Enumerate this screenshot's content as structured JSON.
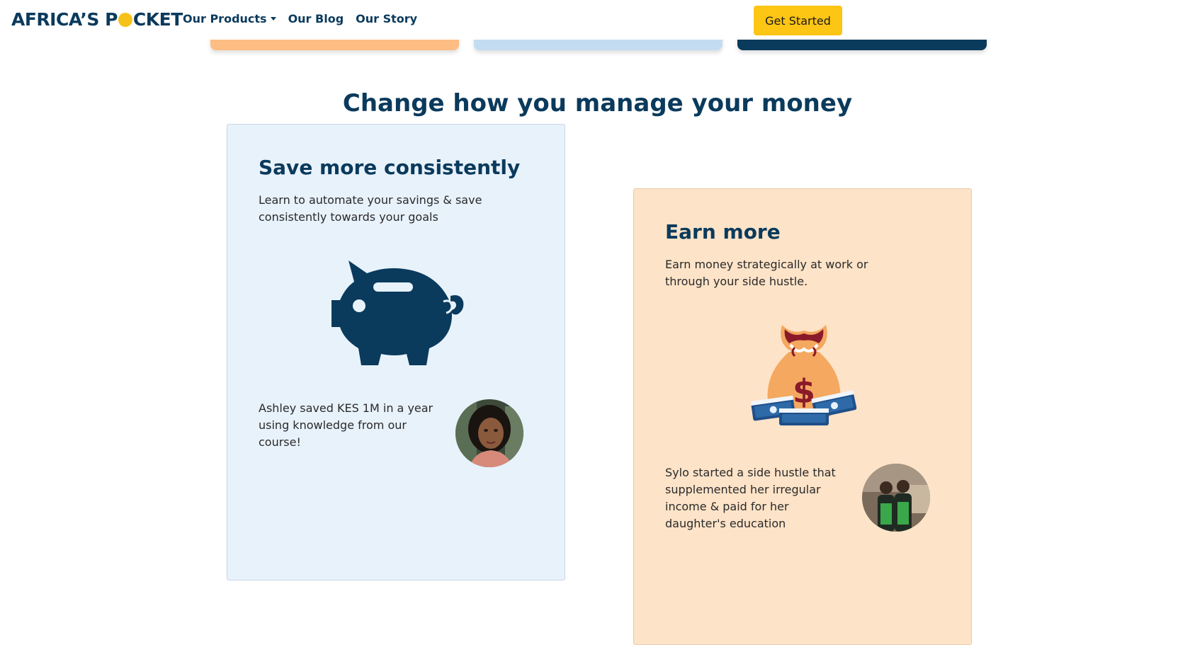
{
  "nav": {
    "brand_left": "AFRICA’S P",
    "brand_right": "CKET",
    "products": "Our Products",
    "blog": "Our Blog",
    "story": "Our Story",
    "cta": "Get Started"
  },
  "section": {
    "title": "Change how you manage your money"
  },
  "cards": {
    "save": {
      "title": "Save more consistently",
      "description": "Learn to automate your savings & save consistently towards your goals",
      "testimonial": "Ashley saved KES 1M in a year using knowledge from our course!",
      "icon": "piggy-bank-icon"
    },
    "earn": {
      "title": "Earn more",
      "description": "Earn money strategically at work or through your side hustle.",
      "testimonial": "Sylo started a side hustle that supplemented her irregular income & paid for her daughter's education",
      "icon": "money-bag-icon"
    }
  },
  "colors": {
    "navy": "#0a3a5c",
    "yellow": "#fdc514",
    "save_bg": "#e8f2fb",
    "earn_bg": "#fde3c8",
    "peach": "#fdbd83",
    "light_blue": "#c4dcf1"
  }
}
